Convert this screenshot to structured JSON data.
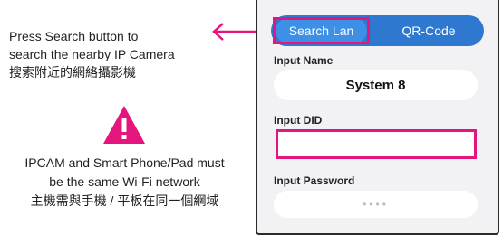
{
  "instructions": {
    "line1": "Press Search button to",
    "line2": "search the nearby IP Camera",
    "line3": "搜索附近的網絡攝影機"
  },
  "note": {
    "line1": "IPCAM and Smart Phone/Pad must",
    "line2": "be the same Wi-Fi network",
    "line3": "主機需與手機 / 平板在同一個網域"
  },
  "colors": {
    "accent": "#e5157e",
    "tab_bar": "#2e79cf",
    "tab_active": "#3e8fe6"
  },
  "app": {
    "tabs": [
      {
        "label": "Search Lan",
        "active": true
      },
      {
        "label": "QR-Code",
        "active": false
      }
    ],
    "fields": {
      "name": {
        "label": "Input Name",
        "value": "System 8"
      },
      "did": {
        "label": "Input DID",
        "value": ""
      },
      "password": {
        "label": "Input Password",
        "value": "••••"
      }
    }
  }
}
